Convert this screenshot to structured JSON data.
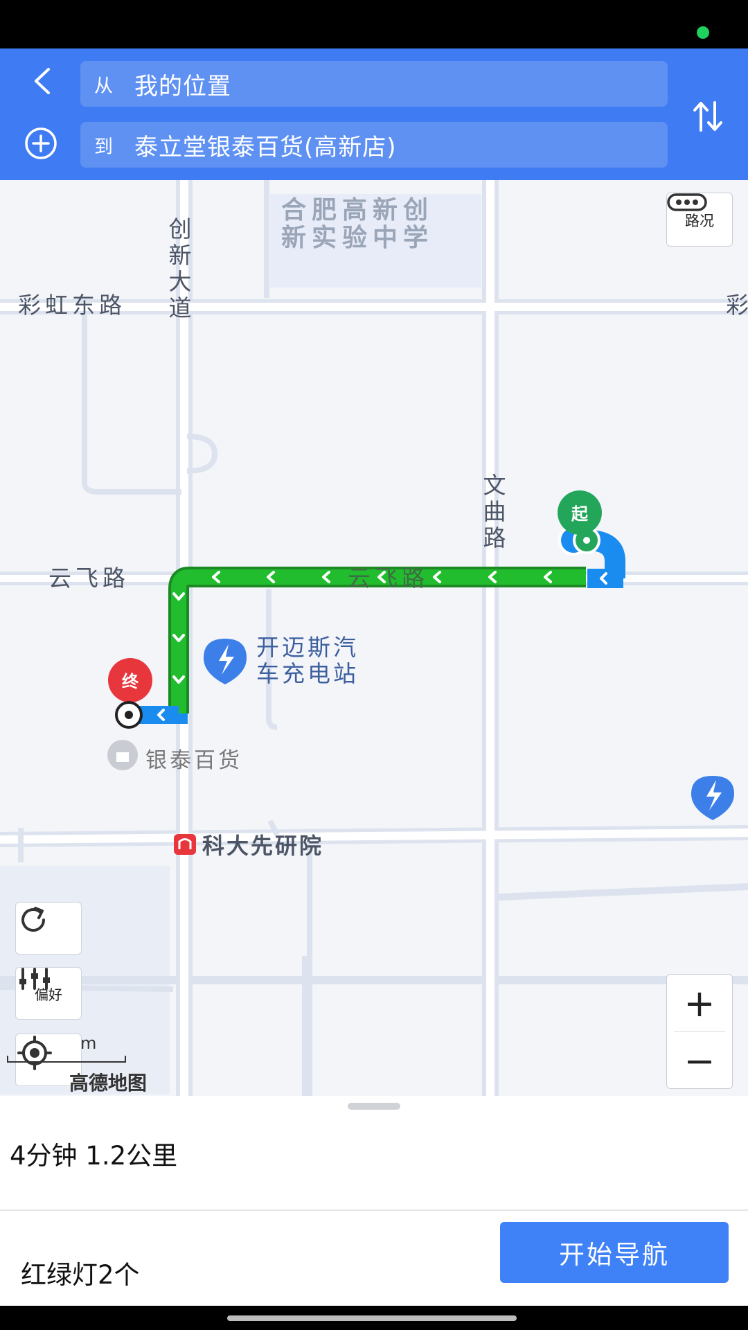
{
  "header": {
    "from_prefix": "从",
    "from_value": "我的位置",
    "to_prefix": "到",
    "to_value": "泰立堂银泰百货(高新店)"
  },
  "map": {
    "roads": {
      "caihong_left": "彩虹东路",
      "caihong_right": "彩",
      "chuangxin": [
        "创",
        "新",
        "大",
        "道"
      ],
      "wenqu": [
        "文",
        "曲",
        "路"
      ],
      "yunfei_left": "云飞路",
      "yunfei_center": "云飞路"
    },
    "school": [
      "合肥高新创",
      "新实验中学"
    ],
    "charging_station": [
      "开迈斯汽",
      "车充电站"
    ],
    "poi_yintai": "银泰百货",
    "subway_station": "科大先研院",
    "start_marker": "起",
    "end_marker": "终",
    "traffic_label": "路况",
    "preference_label": "偏好",
    "scale_text": "m",
    "logo_text": "高德地图",
    "zoom_in": "+",
    "zoom_out": "−"
  },
  "route": {
    "summary": "4分钟 1.2公里",
    "traffic_lights": "红绿灯2个",
    "start_nav_label": "开始导航"
  },
  "colors": {
    "header_bg": "#3f7bf2",
    "route_green": "#1fba2f",
    "route_blue": "#1a8cf0",
    "start_green": "#24a65a",
    "end_red": "#e8363d",
    "start_button": "#3f82f7"
  }
}
